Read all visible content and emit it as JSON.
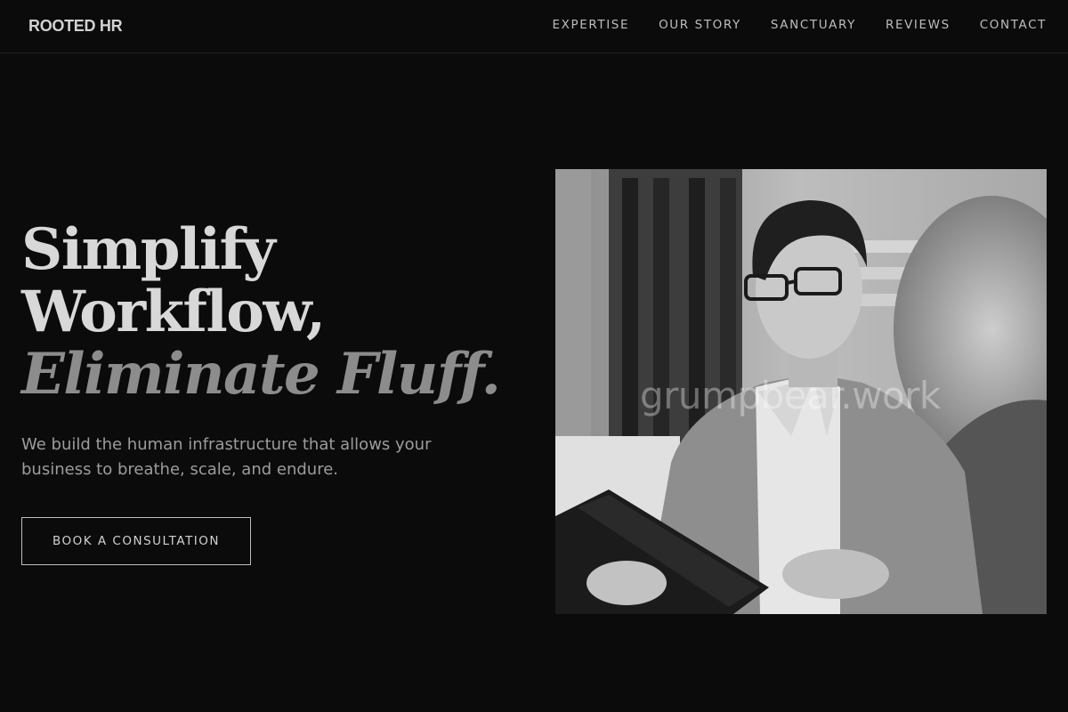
{
  "header": {
    "logo": "ROOTED HR",
    "nav": [
      {
        "label": "EXPERTISE"
      },
      {
        "label": "OUR STORY"
      },
      {
        "label": "SANCTUARY"
      },
      {
        "label": "REVIEWS"
      },
      {
        "label": "CONTACT"
      }
    ]
  },
  "hero": {
    "headline_line1": "Simplify",
    "headline_line2": "Workflow,",
    "headline_line3": "Eliminate Fluff.",
    "subtext": "We build the human infrastructure that allows your business to breathe, scale, and endure.",
    "cta_label": "BOOK A CONSULTATION",
    "image_watermark": "grumpbear.work"
  }
}
